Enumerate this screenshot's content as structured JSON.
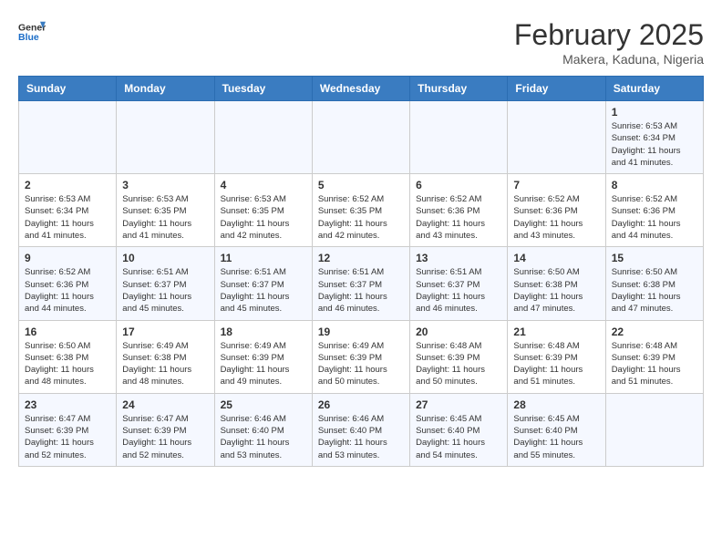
{
  "header": {
    "logo_general": "General",
    "logo_blue": "Blue",
    "month_year": "February 2025",
    "location": "Makera, Kaduna, Nigeria"
  },
  "calendar": {
    "days_of_week": [
      "Sunday",
      "Monday",
      "Tuesday",
      "Wednesday",
      "Thursday",
      "Friday",
      "Saturday"
    ],
    "weeks": [
      [
        {
          "day": "",
          "info": ""
        },
        {
          "day": "",
          "info": ""
        },
        {
          "day": "",
          "info": ""
        },
        {
          "day": "",
          "info": ""
        },
        {
          "day": "",
          "info": ""
        },
        {
          "day": "",
          "info": ""
        },
        {
          "day": "1",
          "info": "Sunrise: 6:53 AM\nSunset: 6:34 PM\nDaylight: 11 hours and 41 minutes."
        }
      ],
      [
        {
          "day": "2",
          "info": "Sunrise: 6:53 AM\nSunset: 6:34 PM\nDaylight: 11 hours and 41 minutes."
        },
        {
          "day": "3",
          "info": "Sunrise: 6:53 AM\nSunset: 6:35 PM\nDaylight: 11 hours and 41 minutes."
        },
        {
          "day": "4",
          "info": "Sunrise: 6:53 AM\nSunset: 6:35 PM\nDaylight: 11 hours and 42 minutes."
        },
        {
          "day": "5",
          "info": "Sunrise: 6:52 AM\nSunset: 6:35 PM\nDaylight: 11 hours and 42 minutes."
        },
        {
          "day": "6",
          "info": "Sunrise: 6:52 AM\nSunset: 6:36 PM\nDaylight: 11 hours and 43 minutes."
        },
        {
          "day": "7",
          "info": "Sunrise: 6:52 AM\nSunset: 6:36 PM\nDaylight: 11 hours and 43 minutes."
        },
        {
          "day": "8",
          "info": "Sunrise: 6:52 AM\nSunset: 6:36 PM\nDaylight: 11 hours and 44 minutes."
        }
      ],
      [
        {
          "day": "9",
          "info": "Sunrise: 6:52 AM\nSunset: 6:36 PM\nDaylight: 11 hours and 44 minutes."
        },
        {
          "day": "10",
          "info": "Sunrise: 6:51 AM\nSunset: 6:37 PM\nDaylight: 11 hours and 45 minutes."
        },
        {
          "day": "11",
          "info": "Sunrise: 6:51 AM\nSunset: 6:37 PM\nDaylight: 11 hours and 45 minutes."
        },
        {
          "day": "12",
          "info": "Sunrise: 6:51 AM\nSunset: 6:37 PM\nDaylight: 11 hours and 46 minutes."
        },
        {
          "day": "13",
          "info": "Sunrise: 6:51 AM\nSunset: 6:37 PM\nDaylight: 11 hours and 46 minutes."
        },
        {
          "day": "14",
          "info": "Sunrise: 6:50 AM\nSunset: 6:38 PM\nDaylight: 11 hours and 47 minutes."
        },
        {
          "day": "15",
          "info": "Sunrise: 6:50 AM\nSunset: 6:38 PM\nDaylight: 11 hours and 47 minutes."
        }
      ],
      [
        {
          "day": "16",
          "info": "Sunrise: 6:50 AM\nSunset: 6:38 PM\nDaylight: 11 hours and 48 minutes."
        },
        {
          "day": "17",
          "info": "Sunrise: 6:49 AM\nSunset: 6:38 PM\nDaylight: 11 hours and 48 minutes."
        },
        {
          "day": "18",
          "info": "Sunrise: 6:49 AM\nSunset: 6:39 PM\nDaylight: 11 hours and 49 minutes."
        },
        {
          "day": "19",
          "info": "Sunrise: 6:49 AM\nSunset: 6:39 PM\nDaylight: 11 hours and 50 minutes."
        },
        {
          "day": "20",
          "info": "Sunrise: 6:48 AM\nSunset: 6:39 PM\nDaylight: 11 hours and 50 minutes."
        },
        {
          "day": "21",
          "info": "Sunrise: 6:48 AM\nSunset: 6:39 PM\nDaylight: 11 hours and 51 minutes."
        },
        {
          "day": "22",
          "info": "Sunrise: 6:48 AM\nSunset: 6:39 PM\nDaylight: 11 hours and 51 minutes."
        }
      ],
      [
        {
          "day": "23",
          "info": "Sunrise: 6:47 AM\nSunset: 6:39 PM\nDaylight: 11 hours and 52 minutes."
        },
        {
          "day": "24",
          "info": "Sunrise: 6:47 AM\nSunset: 6:39 PM\nDaylight: 11 hours and 52 minutes."
        },
        {
          "day": "25",
          "info": "Sunrise: 6:46 AM\nSunset: 6:40 PM\nDaylight: 11 hours and 53 minutes."
        },
        {
          "day": "26",
          "info": "Sunrise: 6:46 AM\nSunset: 6:40 PM\nDaylight: 11 hours and 53 minutes."
        },
        {
          "day": "27",
          "info": "Sunrise: 6:45 AM\nSunset: 6:40 PM\nDaylight: 11 hours and 54 minutes."
        },
        {
          "day": "28",
          "info": "Sunrise: 6:45 AM\nSunset: 6:40 PM\nDaylight: 11 hours and 55 minutes."
        },
        {
          "day": "",
          "info": ""
        }
      ]
    ]
  }
}
